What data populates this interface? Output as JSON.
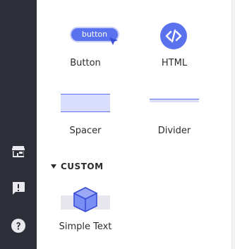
{
  "sidebar": {
    "icons": [
      "store-icon",
      "feedback-icon",
      "help-icon"
    ]
  },
  "blocks": {
    "button": {
      "label": "Button",
      "preview_text": "button"
    },
    "html": {
      "label": "HTML"
    },
    "spacer": {
      "label": "Spacer"
    },
    "divider": {
      "label": "Divider"
    }
  },
  "custom": {
    "section_title": "CUSTOM",
    "blocks": {
      "simple_text": {
        "label": "Simple Text"
      }
    }
  },
  "colors": {
    "accent": "#5b72ee",
    "accent_light": "#d8defc",
    "rail": "#2c2f37"
  }
}
